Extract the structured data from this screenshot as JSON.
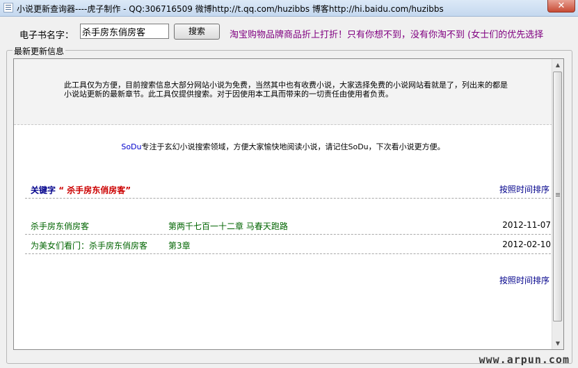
{
  "window": {
    "title": "小说更新查询器----虎子制作 - QQ:306716509 微博http://t.qq.com/huzibbs 博客http://hi.baidu.com/huzibbs",
    "close_label": "✕"
  },
  "search": {
    "label": "电子书名字：",
    "value": "杀手房东俏房客",
    "button_label": "搜索",
    "promo": "淘宝购物品牌商品折上打折！只有你想不到，没有你淘不到 (女士们的优先选择"
  },
  "group": {
    "title": "最新更新信息"
  },
  "content": {
    "notice": "此工具仅为方便，目前搜索信息大部分网站小说为免费，当然其中也有收费小说，大家选择免费的小说网站看就是了，列出来的都是小说站更新的最新章节。此工具仅提供搜索。对于因使用本工具而带来的一切责任由使用者负责。",
    "sodu_name": "SoDu",
    "sodu_text": "专注于玄幻小说搜索领域，方便大家愉快地阅读小说，请记住SoDu，下次看小说更方便。",
    "keyword_label": "关键字",
    "keyword_value": "“ 杀手房东俏房客”",
    "sort_label": "按照时间排序",
    "results": [
      {
        "title": "杀手房东俏房客",
        "chapter": "第两千七百一十二章 马春天跑路",
        "date": "2012-11-07"
      },
      {
        "title": "为美女们看门：杀手房东俏房客",
        "chapter": "第3章",
        "date": "2012-02-10"
      }
    ]
  },
  "watermark": "www.arpun.com",
  "icons": {
    "app": "app-window-icon",
    "scroll_up": "scroll-up-arrow-icon",
    "scroll_down": "scroll-down-arrow-icon"
  }
}
